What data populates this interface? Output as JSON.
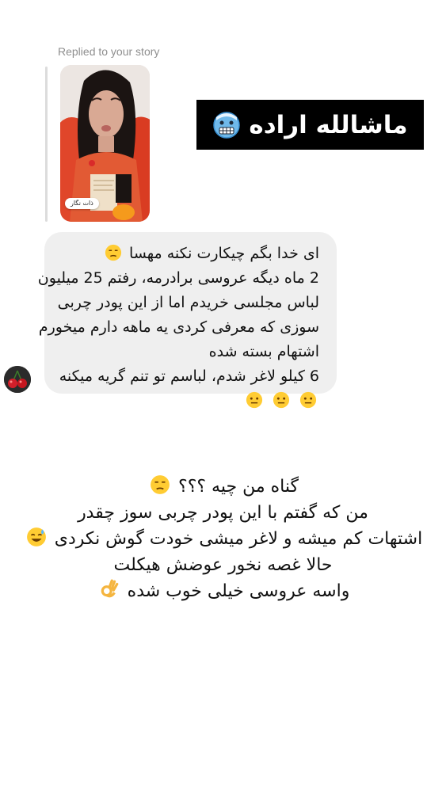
{
  "reply_header": "Replied to your story",
  "story": {
    "chip_text": "ذات نگار",
    "caption": "ماشالله اراده",
    "caption_emoji": "freezing-face-icon"
  },
  "message": {
    "lines": [
      "ای خدا بگم چیکارت نکنه مهسا",
      "2 ماه دیگه عروسی برادرمه، رفتم 25 میلیون",
      "لباس مجلسی خریدم اما از این پودر چربی",
      "سوزی که معرفی کردی یه ماهه دارم میخورم",
      "اشتهام بسته شده",
      "6 کیلو لاغر شدم، لباسم تو تنم گریه میکنه"
    ],
    "emojis": [
      "unamused-face-icon",
      "neutral-face-icon"
    ],
    "sender_avatar": "cherries-avatar"
  },
  "response": {
    "lines": [
      "گناه من چیه ؟؟؟",
      "من که گفتم با این پودر چربی سوز چقدر",
      "اشتهات کم میشه و لاغر میشی خودت گوش نکردی",
      "حالا غصه نخور عوضش هیکلت",
      "واسه عروسی خیلی خوب شده"
    ],
    "emojis": [
      "unamused-face-icon",
      "sweat-smile-icon",
      "ok-hand-icon"
    ]
  }
}
